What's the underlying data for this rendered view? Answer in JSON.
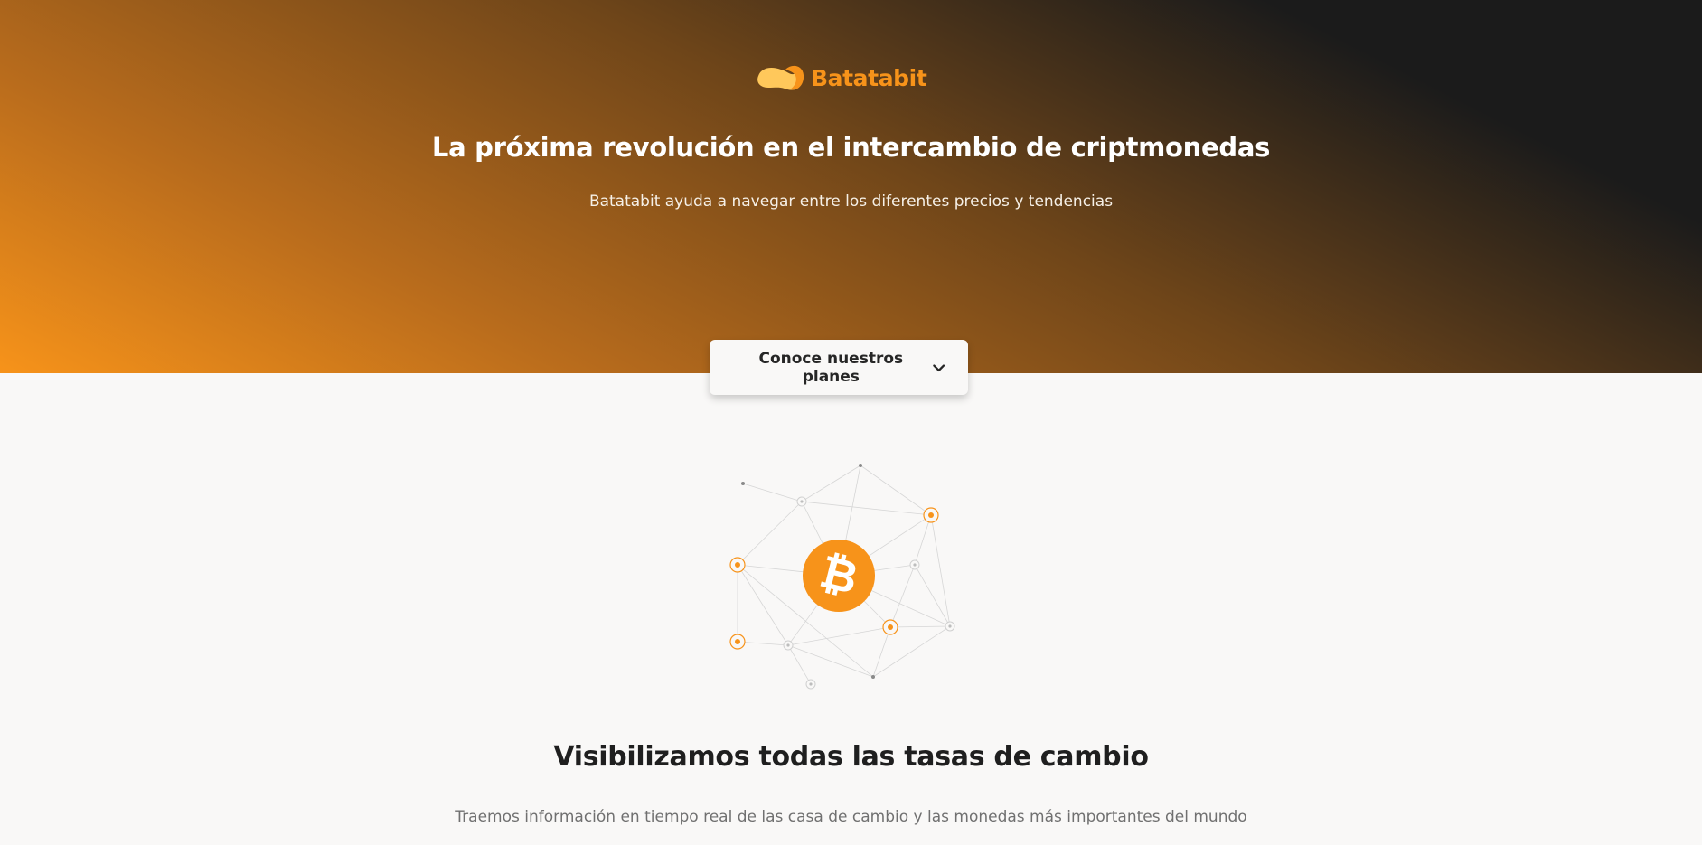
{
  "brand": {
    "name": "Batatabit",
    "logo_icon": "potato-logo-icon",
    "accent_color": "#F7931A",
    "light_accent_color": "#FFC85B",
    "dark_color": "#1B1B1B"
  },
  "hero": {
    "title": "La próxima revolución en el intercambio de criptmonedas",
    "subtitle": "Batatabit ayuda a navegar entre los diferentes precios y tendencias",
    "plans_button": {
      "label": "Conoce nuestros planes",
      "icon": "chevron-down-icon"
    }
  },
  "illustration": {
    "center_icon": "bitcoin-icon",
    "background_icon": "network-graph-icon"
  },
  "section": {
    "title": "Visibilizamos todas las tasas de cambio",
    "text": "Traemos información en tiempo real de las casa de cambio y las monedas más importantes del mundo"
  }
}
